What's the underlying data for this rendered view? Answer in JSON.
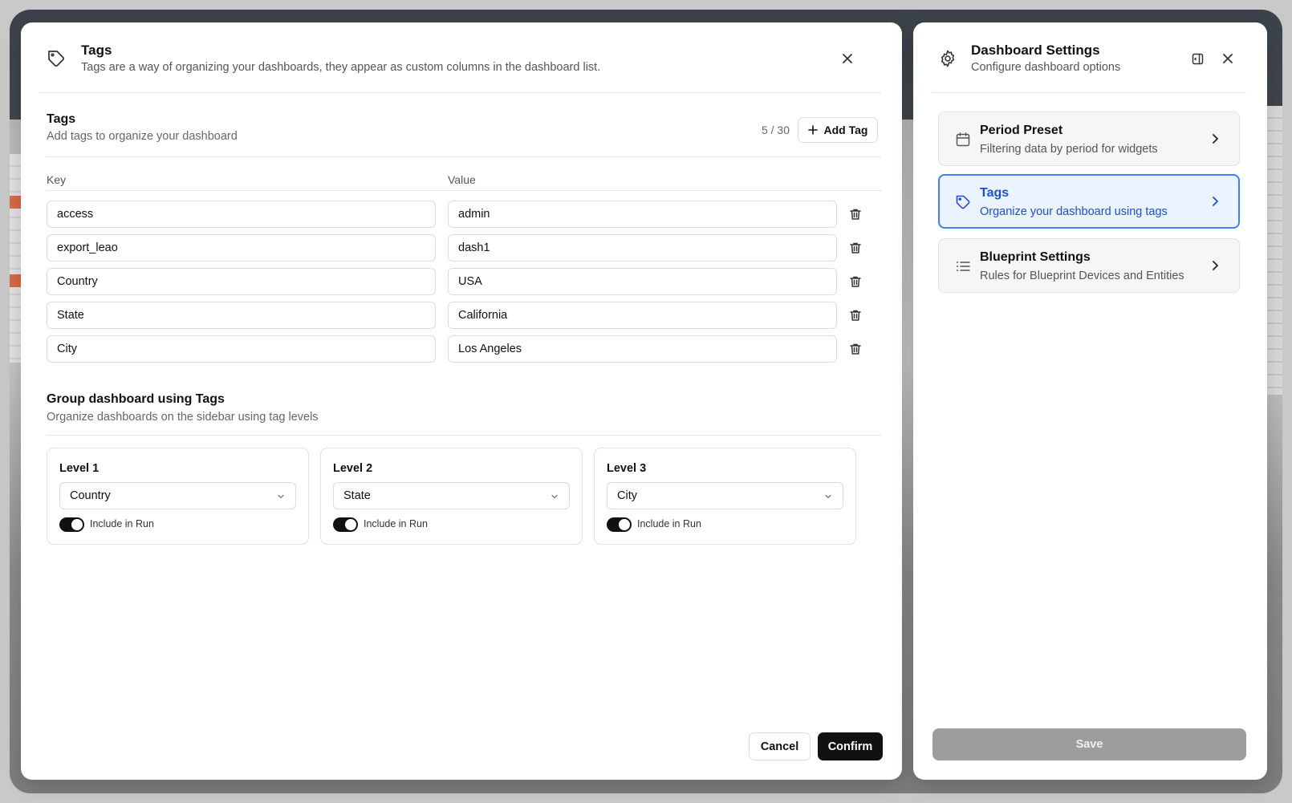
{
  "tags_modal": {
    "title": "Tags",
    "subtitle": "Tags are a way of organizing your dashboards, they appear as custom columns in the dashboard list.",
    "section_title": "Tags",
    "section_subtitle": "Add tags to organize your dashboard",
    "count": "5 / 30",
    "add_tag_label": "Add Tag",
    "key_header": "Key",
    "value_header": "Value",
    "rows": [
      {
        "key": "access",
        "value": "admin"
      },
      {
        "key": "export_leao",
        "value": "dash1"
      },
      {
        "key": "Country",
        "value": "USA"
      },
      {
        "key": "State",
        "value": "California"
      },
      {
        "key": "City",
        "value": "Los Angeles"
      }
    ],
    "group_title": "Group dashboard using Tags",
    "group_subtitle": "Organize dashboards on the sidebar using tag levels",
    "levels": [
      {
        "title": "Level 1",
        "selected": "Country",
        "toggle_label": "Include in Run",
        "toggle_on": true
      },
      {
        "title": "Level 2",
        "selected": "State",
        "toggle_label": "Include in Run",
        "toggle_on": true
      },
      {
        "title": "Level 3",
        "selected": "City",
        "toggle_label": "Include in Run",
        "toggle_on": true
      }
    ],
    "cancel_label": "Cancel",
    "confirm_label": "Confirm"
  },
  "settings_panel": {
    "title": "Dashboard Settings",
    "subtitle": "Configure dashboard options",
    "items": [
      {
        "title": "Period Preset",
        "subtitle": "Filtering data by period for widgets",
        "icon": "calendar-icon",
        "active": false
      },
      {
        "title": "Tags",
        "subtitle": "Organize your dashboard using tags",
        "icon": "tag-icon",
        "active": true
      },
      {
        "title": "Blueprint Settings",
        "subtitle": "Rules for Blueprint Devices and Entities",
        "icon": "list-icon",
        "active": false
      }
    ],
    "save_label": "Save"
  },
  "colors": {
    "accent": "#3b82f6",
    "accent_text": "#1d4fd7",
    "primary_button": "#111111",
    "disabled_button": "#9d9d9d"
  }
}
